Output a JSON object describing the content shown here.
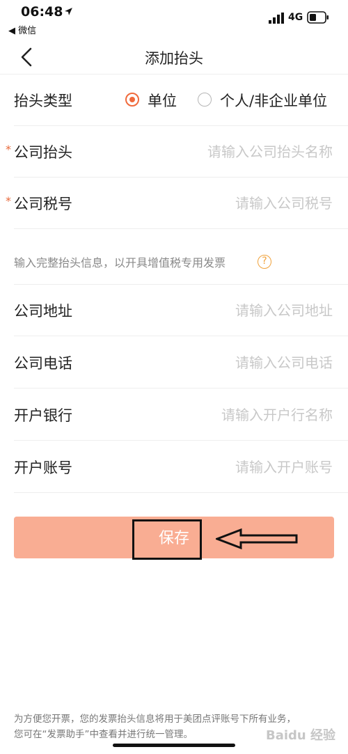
{
  "status_bar": {
    "time": "06:48",
    "back_app": "◀ 微信",
    "network": "4G"
  },
  "nav": {
    "title": "添加抬头"
  },
  "form": {
    "header_type": {
      "label": "抬头类型",
      "options": [
        {
          "label": "单位",
          "checked": true
        },
        {
          "label": "个人/非企业单位",
          "checked": false
        }
      ]
    },
    "company_name": {
      "label": "公司抬头",
      "placeholder": "请输入公司抬头名称",
      "value": ""
    },
    "tax_id": {
      "label": "公司税号",
      "placeholder": "请输入公司税号",
      "value": ""
    },
    "hint": "输入完整抬头信息，以开具增值税专用发票",
    "help_icon": "?",
    "address": {
      "label": "公司地址",
      "placeholder": "请输入公司地址",
      "value": ""
    },
    "phone": {
      "label": "公司电话",
      "placeholder": "请输入公司电话",
      "value": ""
    },
    "bank": {
      "label": "开户银行",
      "placeholder": "请输入开户行名称",
      "value": ""
    },
    "account": {
      "label": "开户账号",
      "placeholder": "请输入开户账号",
      "value": ""
    },
    "required_mark": "*"
  },
  "save_label": "保存",
  "footer": {
    "line1": "为方便您开票，您的发票抬头信息将用于美团点评账号下所有业务，",
    "line2": "您可在“发票助手”中查看并进行统一管理。"
  },
  "watermark": "Baidu 经验",
  "colors": {
    "accent": "#f06a3c",
    "save_button": "#f9ad93",
    "help_icon": "#f0a23c"
  },
  "icons": {
    "back": "chevron-left-icon",
    "location": "location-arrow-icon",
    "signal": "signal-icon",
    "battery": "battery-icon",
    "help": "question-circle-icon",
    "annotation": "annotation-arrow-icon"
  }
}
